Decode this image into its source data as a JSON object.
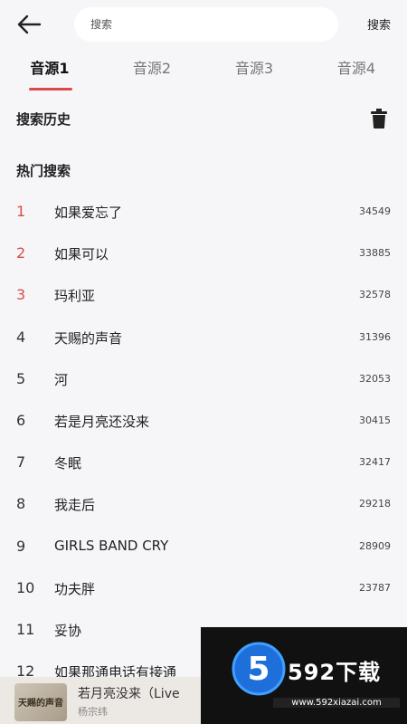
{
  "header": {
    "search_placeholder": "搜索",
    "search_button": "搜索"
  },
  "tabs": [
    {
      "label": "音源1",
      "active": true
    },
    {
      "label": "音源2",
      "active": false
    },
    {
      "label": "音源3",
      "active": false
    },
    {
      "label": "音源4",
      "active": false
    }
  ],
  "history": {
    "title": "搜索历史",
    "clear_icon": "trash-icon"
  },
  "hot": {
    "title": "热门搜索",
    "items": [
      {
        "rank": "1",
        "title": "如果爱忘了",
        "count": "34549",
        "highlight": true
      },
      {
        "rank": "2",
        "title": "如果可以",
        "count": "33885",
        "highlight": true
      },
      {
        "rank": "3",
        "title": "玛利亚",
        "count": "32578",
        "highlight": true
      },
      {
        "rank": "4",
        "title": "天赐的声音",
        "count": "31396",
        "highlight": false
      },
      {
        "rank": "5",
        "title": "河",
        "count": "32053",
        "highlight": false
      },
      {
        "rank": "6",
        "title": "若是月亮还没来",
        "count": "30415",
        "highlight": false
      },
      {
        "rank": "7",
        "title": "冬眠",
        "count": "32417",
        "highlight": false
      },
      {
        "rank": "8",
        "title": "我走后",
        "count": "29218",
        "highlight": false
      },
      {
        "rank": "9",
        "title": "GIRLS BAND CRY",
        "count": "28909",
        "highlight": false
      },
      {
        "rank": "10",
        "title": "功夫胖",
        "count": "23787",
        "highlight": false
      },
      {
        "rank": "11",
        "title": "妥协",
        "count": "",
        "highlight": false
      },
      {
        "rank": "12",
        "title": "如果那通电话有接通",
        "count": "",
        "highlight": false
      }
    ]
  },
  "player": {
    "title": "若月亮没来（Live",
    "artist": "杨宗纬",
    "cover_text": "天赐的声音"
  },
  "watermark": {
    "title": "592下载",
    "url": "www.592xiazai.com"
  },
  "colors": {
    "accent": "#d94b4b",
    "background": "#f6f6f9"
  }
}
